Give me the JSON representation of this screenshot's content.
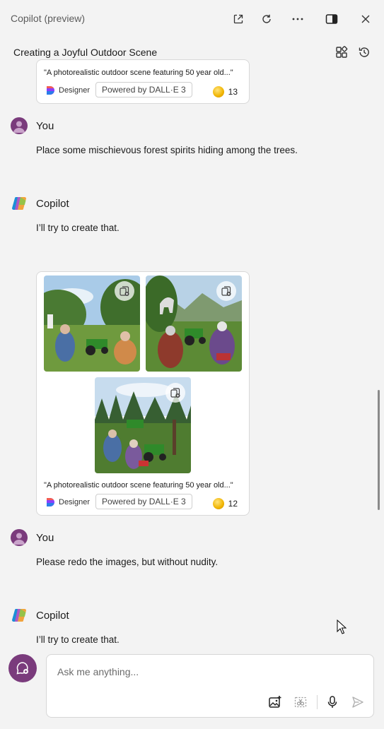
{
  "window": {
    "title": "Copilot (preview)"
  },
  "conversation": {
    "title": "Creating a Joyful Outdoor Scene"
  },
  "colors": {
    "avatar": "#7a3b7c",
    "background": "#f3f3f3",
    "card": "#ffffff",
    "coin": "#f0b400"
  },
  "icons": {
    "titlebar": [
      "open-in-new-window-icon",
      "refresh-icon",
      "more-options-icon",
      "dock-side-icon",
      "close-icon"
    ],
    "header": [
      "plugins-icon",
      "history-icon"
    ],
    "composer": [
      "add-image-icon",
      "screenshot-icon",
      "microphone-icon",
      "send-icon"
    ]
  },
  "top_card": {
    "prompt": "\"A photorealistic outdoor scene featuring 50 year old...\"",
    "designer_label": "Designer",
    "powered_label": "Powered by DALL·E 3",
    "boost_count": "13"
  },
  "messages": [
    {
      "speaker": "You",
      "text": "Place some mischievous forest spirits hiding among the trees."
    },
    {
      "speaker": "Copilot",
      "text": "I’ll try to create that."
    },
    {
      "speaker": "You",
      "text": "Please redo the images, but without nudity."
    },
    {
      "speaker": "Copilot",
      "text": "I’ll try to create that."
    }
  ],
  "image_card": {
    "prompt": "\"A photorealistic outdoor scene featuring 50 year old...\"",
    "designer_label": "Designer",
    "powered_label": "Powered by DALL·E 3",
    "boost_count": "12"
  },
  "composer": {
    "placeholder": "Ask me anything..."
  }
}
